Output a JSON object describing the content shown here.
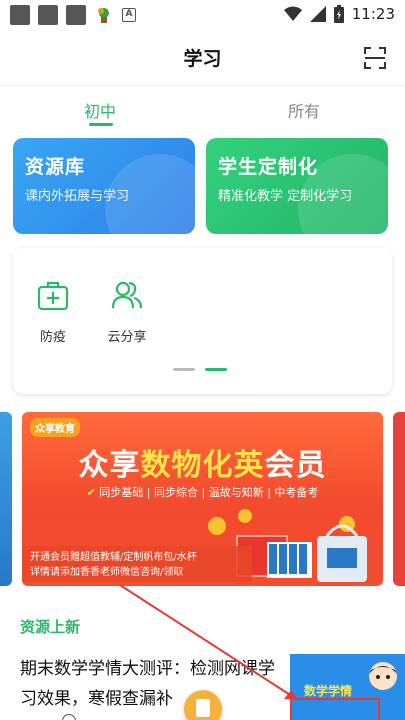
{
  "status_bar": {
    "time": "11:23",
    "notification_letter": "A"
  },
  "header": {
    "title": "学习",
    "scan_icon": "scan-icon"
  },
  "tabs": [
    {
      "label": "初中",
      "active": true
    },
    {
      "label": "所有",
      "active": false
    }
  ],
  "cards": [
    {
      "title": "资源库",
      "subtitle": "课内外拓展与学习"
    },
    {
      "title": "学生定制化",
      "subtitle": "精准化教学  定制化学习"
    }
  ],
  "tools": [
    {
      "label": "防疫",
      "icon": "medical-kit-icon"
    },
    {
      "label": "云分享",
      "icon": "people-icon"
    }
  ],
  "carousel": {
    "pages": 2,
    "active_index": 1
  },
  "banner": {
    "logo": "众享教育",
    "headline_a": "众享",
    "headline_b": "数物化英",
    "headline_c": "会员",
    "tags": "同步基础 | 同步综合 | 温故与知新 | 中考备考",
    "desc_line1": "开通会员赠超值教辅/定制帆布包/水杯",
    "desc_line2": "详情请添加香香老师微信咨询/领取"
  },
  "section": {
    "title": "资源上新"
  },
  "article": {
    "title": "期末数学学情大测评：检测网课学习效果，寒假查漏补",
    "thumb_text": "数学学情"
  },
  "colors": {
    "accent": "#2cb86a",
    "card_blue": "#2e7fe8",
    "card_green": "#22b468",
    "banner_red": "#f24a2e",
    "highlight": "#e53935"
  }
}
